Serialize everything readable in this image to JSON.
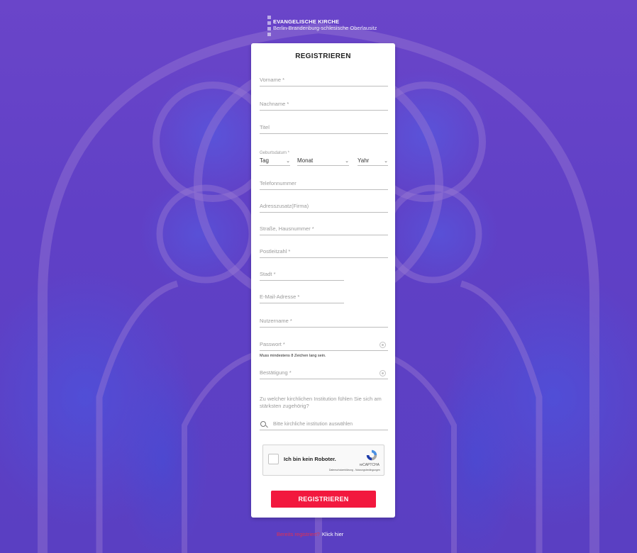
{
  "logo": {
    "title": "EVANGELISCHE KIRCHE",
    "subtitle": "Berlin-Brandenburg-schlesische Oberlausitz"
  },
  "form": {
    "title": "REGISTRIEREN",
    "fields": {
      "vorname": "Vorname *",
      "nachname": "Nachname *",
      "titel": "Titel",
      "telefon": "Telefonnummer",
      "adresszusatz": "Adresszusatz(Firma)",
      "strasse": "Straße, Hausnummer *",
      "plz": "Postleitzahl *",
      "stadt": "Stadt *",
      "email": "E-Mail-Adresse *",
      "nutzername": "Nutzername *",
      "passwort": "Passwort *",
      "bestaetigung": "Bestätigung *"
    },
    "birthdate": {
      "label": "Geburtsdatum *",
      "day": "Tag",
      "month": "Monat",
      "year": "Yahr"
    },
    "password_hint": "Muss mindestens 8 Zeichen lang sein.",
    "institution_question": "Zu welcher kirchlichen Institution fühlen Sie sich am stärksten zugehörig?",
    "institution_placeholder": "Bitte kirchliche institution auswählen",
    "captcha": {
      "label": "Ich bin kein Roboter.",
      "brand": "reCAPTCHA",
      "links": "Datenschutzerklärung - Nutzungsbedingungen"
    },
    "submit_label": "REGISTRIEREN"
  },
  "footer": {
    "question": "Bereits registriert?",
    "link": "Klick hier"
  },
  "colors": {
    "background": "#5a3bc4",
    "accent": "#f2183e"
  }
}
